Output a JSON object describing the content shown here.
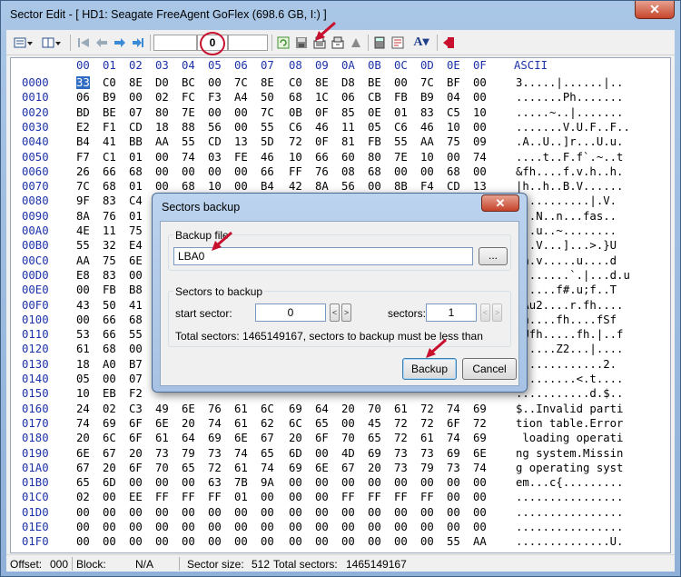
{
  "window": {
    "title": "Sector Edit - [ HD1: Seagate FreeAgent GoFlex (698.6 GB, I:) ]",
    "close_label": "✕"
  },
  "toolbar": {
    "sector_value": "0",
    "icons": [
      "view-mode-icon",
      "columns-icon",
      "first-sector-icon",
      "previous-sector-icon",
      "next-sector-icon",
      "last-sector-icon",
      "refresh-icon",
      "save-icon",
      "backup-sector-icon",
      "restore-sector-icon",
      "clear-icon",
      "calculator-icon",
      "goto-icon",
      "font-icon",
      "exit-icon"
    ]
  },
  "hex": {
    "header": [
      "00",
      "01",
      "02",
      "03",
      "04",
      "05",
      "06",
      "07",
      "08",
      "09",
      "0A",
      "0B",
      "0C",
      "0D",
      "0E",
      "0F"
    ],
    "ascii_title": "ASCII",
    "rows": [
      {
        "off": "0000",
        "b": [
          "33",
          "C0",
          "8E",
          "D0",
          "BC",
          "00",
          "7C",
          "8E",
          "C0",
          "8E",
          "D8",
          "BE",
          "00",
          "7C",
          "BF",
          "00"
        ],
        "a": "3.....|......|.."
      },
      {
        "off": "0010",
        "b": [
          "06",
          "B9",
          "00",
          "02",
          "FC",
          "F3",
          "A4",
          "50",
          "68",
          "1C",
          "06",
          "CB",
          "FB",
          "B9",
          "04",
          "00"
        ],
        "a": ".......Ph......."
      },
      {
        "off": "0020",
        "b": [
          "BD",
          "BE",
          "07",
          "80",
          "7E",
          "00",
          "00",
          "7C",
          "0B",
          "0F",
          "85",
          "0E",
          "01",
          "83",
          "C5",
          "10"
        ],
        "a": ".....~..|......."
      },
      {
        "off": "0030",
        "b": [
          "E2",
          "F1",
          "CD",
          "18",
          "88",
          "56",
          "00",
          "55",
          "C6",
          "46",
          "11",
          "05",
          "C6",
          "46",
          "10",
          "00"
        ],
        "a": ".......V.U.F..F.."
      },
      {
        "off": "0040",
        "b": [
          "B4",
          "41",
          "BB",
          "AA",
          "55",
          "CD",
          "13",
          "5D",
          "72",
          "0F",
          "81",
          "FB",
          "55",
          "AA",
          "75",
          "09"
        ],
        "a": ".A..U..]r...U.u."
      },
      {
        "off": "0050",
        "b": [
          "F7",
          "C1",
          "01",
          "00",
          "74",
          "03",
          "FE",
          "46",
          "10",
          "66",
          "60",
          "80",
          "7E",
          "10",
          "00",
          "74"
        ],
        "a": "....t..F.f`.~..t"
      },
      {
        "off": "0060",
        "b": [
          "26",
          "66",
          "68",
          "00",
          "00",
          "00",
          "00",
          "66",
          "FF",
          "76",
          "08",
          "68",
          "00",
          "00",
          "68",
          "00"
        ],
        "a": "&fh....f.v.h..h."
      },
      {
        "off": "0070",
        "b": [
          "7C",
          "68",
          "01",
          "00",
          "68",
          "10",
          "00",
          "B4",
          "42",
          "8A",
          "56",
          "00",
          "8B",
          "F4",
          "CD",
          "13"
        ],
        "a": "|h..h..B.V......"
      },
      {
        "off": "0080",
        "b": [
          "9F",
          "83",
          "C4",
          "",
          "",
          "",
          "",
          "",
          "",
          "",
          "",
          "",
          "",
          "",
          "",
          ""
        ],
        "a": "...........|.V."
      },
      {
        "off": "0090",
        "b": [
          "8A",
          "76",
          "01",
          "",
          "",
          "",
          "",
          "",
          "",
          "",
          "",
          "",
          "",
          "",
          "",
          ""
        ],
        "a": "v..N..n...fas.."
      },
      {
        "off": "00A0",
        "b": [
          "4E",
          "11",
          "75",
          "",
          "",
          "",
          "",
          "",
          "",
          "",
          "",
          "",
          "",
          "",
          "",
          ""
        ],
        "a": "N..u..~........"
      },
      {
        "off": "00B0",
        "b": [
          "55",
          "32",
          "E4",
          "",
          "",
          "",
          "",
          "",
          "",
          "",
          "",
          "",
          "",
          "",
          "",
          ""
        ],
        "a": "2..V...]...>.}U"
      },
      {
        "off": "00C0",
        "b": [
          "AA",
          "75",
          "6E",
          "",
          "",
          "",
          "",
          "",
          "",
          "",
          "",
          "",
          "",
          "",
          "",
          ""
        ],
        "a": "un.v.....u....d"
      },
      {
        "off": "00D0",
        "b": [
          "E8",
          "83",
          "00",
          "",
          "",
          "",
          "",
          "",
          "",
          "",
          "",
          "",
          "",
          "",
          "",
          ""
        ],
        "a": "........`.|...d.u"
      },
      {
        "off": "00E0",
        "b": [
          "00",
          "FB",
          "B8",
          "",
          "",
          "",
          "",
          "",
          "",
          "",
          "",
          "",
          "",
          "",
          "",
          ""
        ],
        "a": "......f#.u;f..T"
      },
      {
        "off": "00F0",
        "b": [
          "43",
          "50",
          "41",
          "",
          "",
          "",
          "",
          "",
          "",
          "",
          "",
          "",
          "",
          "",
          "",
          ""
        ],
        "a": "PAu2....r.fh...."
      },
      {
        "off": "0100",
        "b": [
          "00",
          "66",
          "68",
          "",
          "",
          "",
          "",
          "",
          "",
          "",
          "",
          "",
          "",
          "",
          "",
          ""
        ],
        "a": "fh....fh....fSf"
      },
      {
        "off": "0110",
        "b": [
          "53",
          "66",
          "55",
          "",
          "",
          "",
          "",
          "",
          "",
          "",
          "",
          "",
          "",
          "",
          "",
          ""
        ],
        "a": "fUfh.....fh.|..f"
      },
      {
        "off": "0120",
        "b": [
          "61",
          "68",
          "00",
          "",
          "",
          "",
          "",
          "",
          "",
          "",
          "",
          "",
          "",
          "",
          "",
          ""
        ],
        "a": "h.....Z2...|...."
      },
      {
        "off": "0130",
        "b": [
          "18",
          "A0",
          "B7",
          "",
          "",
          "",
          "",
          "",
          "",
          "",
          "",
          "",
          "",
          "",
          "",
          ""
        ],
        "a": ".............2."
      },
      {
        "off": "0140",
        "b": [
          "05",
          "00",
          "07",
          "",
          "",
          "",
          "",
          "",
          "",
          "",
          "",
          "",
          "",
          "",
          "",
          ""
        ],
        "a": ".........<.t...."
      },
      {
        "off": "0150",
        "b": [
          "10",
          "EB",
          "F2",
          "",
          "",
          "",
          "",
          "",
          "",
          "",
          "",
          "",
          "",
          "",
          "",
          ""
        ],
        "a": "...........d.$.."
      },
      {
        "off": "0160",
        "b": [
          "24",
          "02",
          "C3",
          "49",
          "6E",
          "76",
          "61",
          "6C",
          "69",
          "64",
          "20",
          "70",
          "61",
          "72",
          "74",
          "69"
        ],
        "a": "$..Invalid parti"
      },
      {
        "off": "0170",
        "b": [
          "74",
          "69",
          "6F",
          "6E",
          "20",
          "74",
          "61",
          "62",
          "6C",
          "65",
          "00",
          "45",
          "72",
          "72",
          "6F",
          "72"
        ],
        "a": "tion table.Error"
      },
      {
        "off": "0180",
        "b": [
          "20",
          "6C",
          "6F",
          "61",
          "64",
          "69",
          "6E",
          "67",
          "20",
          "6F",
          "70",
          "65",
          "72",
          "61",
          "74",
          "69"
        ],
        "a": " loading operati"
      },
      {
        "off": "0190",
        "b": [
          "6E",
          "67",
          "20",
          "73",
          "79",
          "73",
          "74",
          "65",
          "6D",
          "00",
          "4D",
          "69",
          "73",
          "73",
          "69",
          "6E"
        ],
        "a": "ng system.Missin"
      },
      {
        "off": "01A0",
        "b": [
          "67",
          "20",
          "6F",
          "70",
          "65",
          "72",
          "61",
          "74",
          "69",
          "6E",
          "67",
          "20",
          "73",
          "79",
          "73",
          "74"
        ],
        "a": "g operating syst"
      },
      {
        "off": "01B0",
        "b": [
          "65",
          "6D",
          "00",
          "00",
          "00",
          "63",
          "7B",
          "9A",
          "00",
          "00",
          "00",
          "00",
          "00",
          "00",
          "00",
          "00"
        ],
        "a": "em...c{........."
      },
      {
        "off": "01C0",
        "b": [
          "02",
          "00",
          "EE",
          "FF",
          "FF",
          "FF",
          "01",
          "00",
          "00",
          "00",
          "FF",
          "FF",
          "FF",
          "FF",
          "00",
          "00"
        ],
        "a": "................"
      },
      {
        "off": "01D0",
        "b": [
          "00",
          "00",
          "00",
          "00",
          "00",
          "00",
          "00",
          "00",
          "00",
          "00",
          "00",
          "00",
          "00",
          "00",
          "00",
          "00"
        ],
        "a": "................"
      },
      {
        "off": "01E0",
        "b": [
          "00",
          "00",
          "00",
          "00",
          "00",
          "00",
          "00",
          "00",
          "00",
          "00",
          "00",
          "00",
          "00",
          "00",
          "00",
          "00"
        ],
        "a": "................"
      },
      {
        "off": "01F0",
        "b": [
          "00",
          "00",
          "00",
          "00",
          "00",
          "00",
          "00",
          "00",
          "00",
          "00",
          "00",
          "00",
          "00",
          "00",
          "55",
          "AA"
        ],
        "a": "..............U."
      }
    ]
  },
  "status": {
    "offset_label": "Offset:",
    "offset_value": "000",
    "block_label": "Block:",
    "block_value": "N/A",
    "sector_size_label": "Sector size:",
    "sector_size_value": "512",
    "total_sectors_label": "Total sectors:",
    "total_sectors_value": "1465149167"
  },
  "dialog": {
    "title": "Sectors backup",
    "close_label": "✕",
    "backup_file_label": "Backup file",
    "backup_file_value": "LBA0",
    "browse_label": "...",
    "sectors_group_label": "Sectors to backup",
    "start_sector_label": "start sector:",
    "start_sector_value": "0",
    "sectors_label": "sectors:",
    "sectors_value": "1",
    "prev_label": "<",
    "next_label": ">",
    "info_text": "Total sectors: 1465149167, sectors to backup must be less than",
    "backup_button": "Backup",
    "cancel_button": "Cancel"
  },
  "colors": {
    "offset_blue": "#1c33a8",
    "selection": "#2e6cc4",
    "annotation_red": "#c8102e"
  }
}
